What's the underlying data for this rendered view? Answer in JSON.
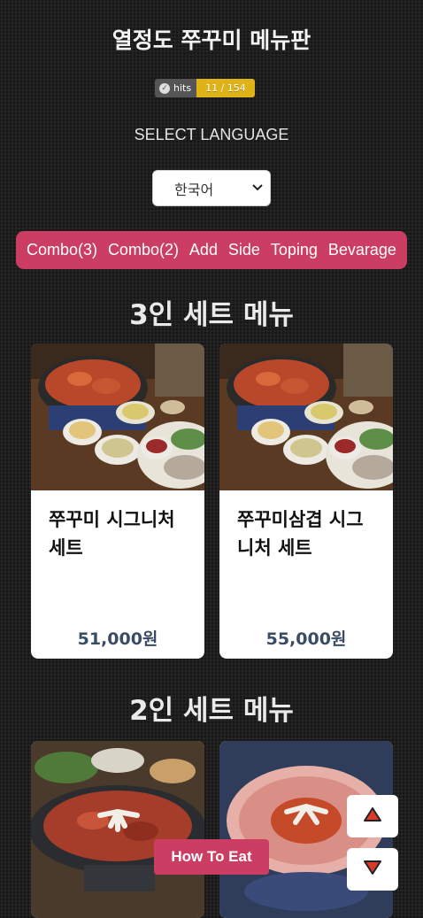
{
  "title": "열정도 쭈꾸미 메뉴판",
  "hits_badge": {
    "label": "hits",
    "value": "11 / 154",
    "icon": "check-circle-icon",
    "accent": "#dfb317"
  },
  "language": {
    "label": "SELECT LANGUAGE",
    "selected": "한국어"
  },
  "nav": {
    "items": [
      "Combo(3)",
      "Combo(2)",
      "Add",
      "Side",
      "Toping",
      "Bevarage"
    ],
    "color": "#cc3d63"
  },
  "sections": [
    {
      "title": "3인 세트 메뉴",
      "items": [
        {
          "name": "쭈꾸미 시그니처 세트",
          "price": "51,000원"
        },
        {
          "name": "쭈꾸미삼겹 시그니처 세트",
          "price": "55,000원"
        }
      ]
    },
    {
      "title": "2인 세트 메뉴"
    }
  ],
  "buttons": {
    "how_to_eat": "How To Eat",
    "scroll_up_icon": "triangle-up-icon",
    "scroll_down_icon": "triangle-down-icon"
  }
}
